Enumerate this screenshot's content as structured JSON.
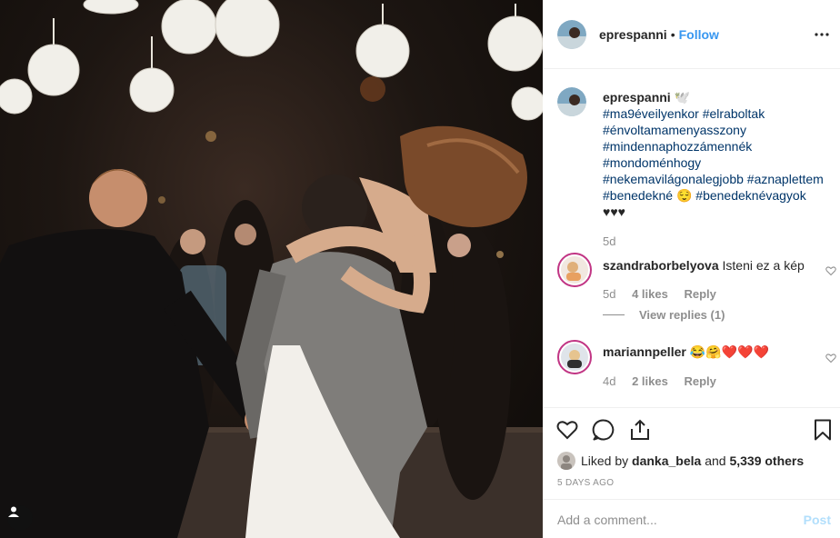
{
  "post": {
    "author": "eprespanni",
    "follow_label": "Follow",
    "dot": "•"
  },
  "caption": {
    "author": "eprespanni",
    "emoji_after_name": "🕊️",
    "lines": [
      "#ma9éveilyenkor #elraboltak",
      "#énvoltamamenyasszony",
      "#mindennaphozzámennék",
      "#mondoménhogy",
      "#nekemavilágonalegjobb #aznaplettem",
      "#benedekné 😌 #benedeknévagyok",
      "♥♥♥"
    ],
    "time": "5d"
  },
  "comments": [
    {
      "author": "szandraborbelyova",
      "text": "Isteni ez a kép",
      "time": "5d",
      "likes": "4 likes",
      "reply": "Reply",
      "view_replies": "View replies (1)"
    },
    {
      "author": "mariannpeller",
      "text": "😂🤗❤️❤️❤️",
      "time": "4d",
      "likes": "2 likes",
      "reply": "Reply"
    }
  ],
  "likes_line": {
    "prefix": "Liked by ",
    "user": "danka_bela",
    "middle": " and ",
    "others": "5,339 others"
  },
  "time_ago": "5 DAYS AGO",
  "add_comment": {
    "placeholder": "Add a comment...",
    "post_label": "Post"
  },
  "icons": {
    "more": "more-dots-icon",
    "like": "heart-icon",
    "comment": "comment-icon",
    "share": "share-icon",
    "save": "bookmark-icon",
    "user_tag": "user-tag-icon"
  },
  "colors": {
    "link": "#3897f0",
    "hashtag": "#003569",
    "muted": "#8e8e8e",
    "heart_red": "#ed4956",
    "post_disabled": "#b2dffc"
  }
}
